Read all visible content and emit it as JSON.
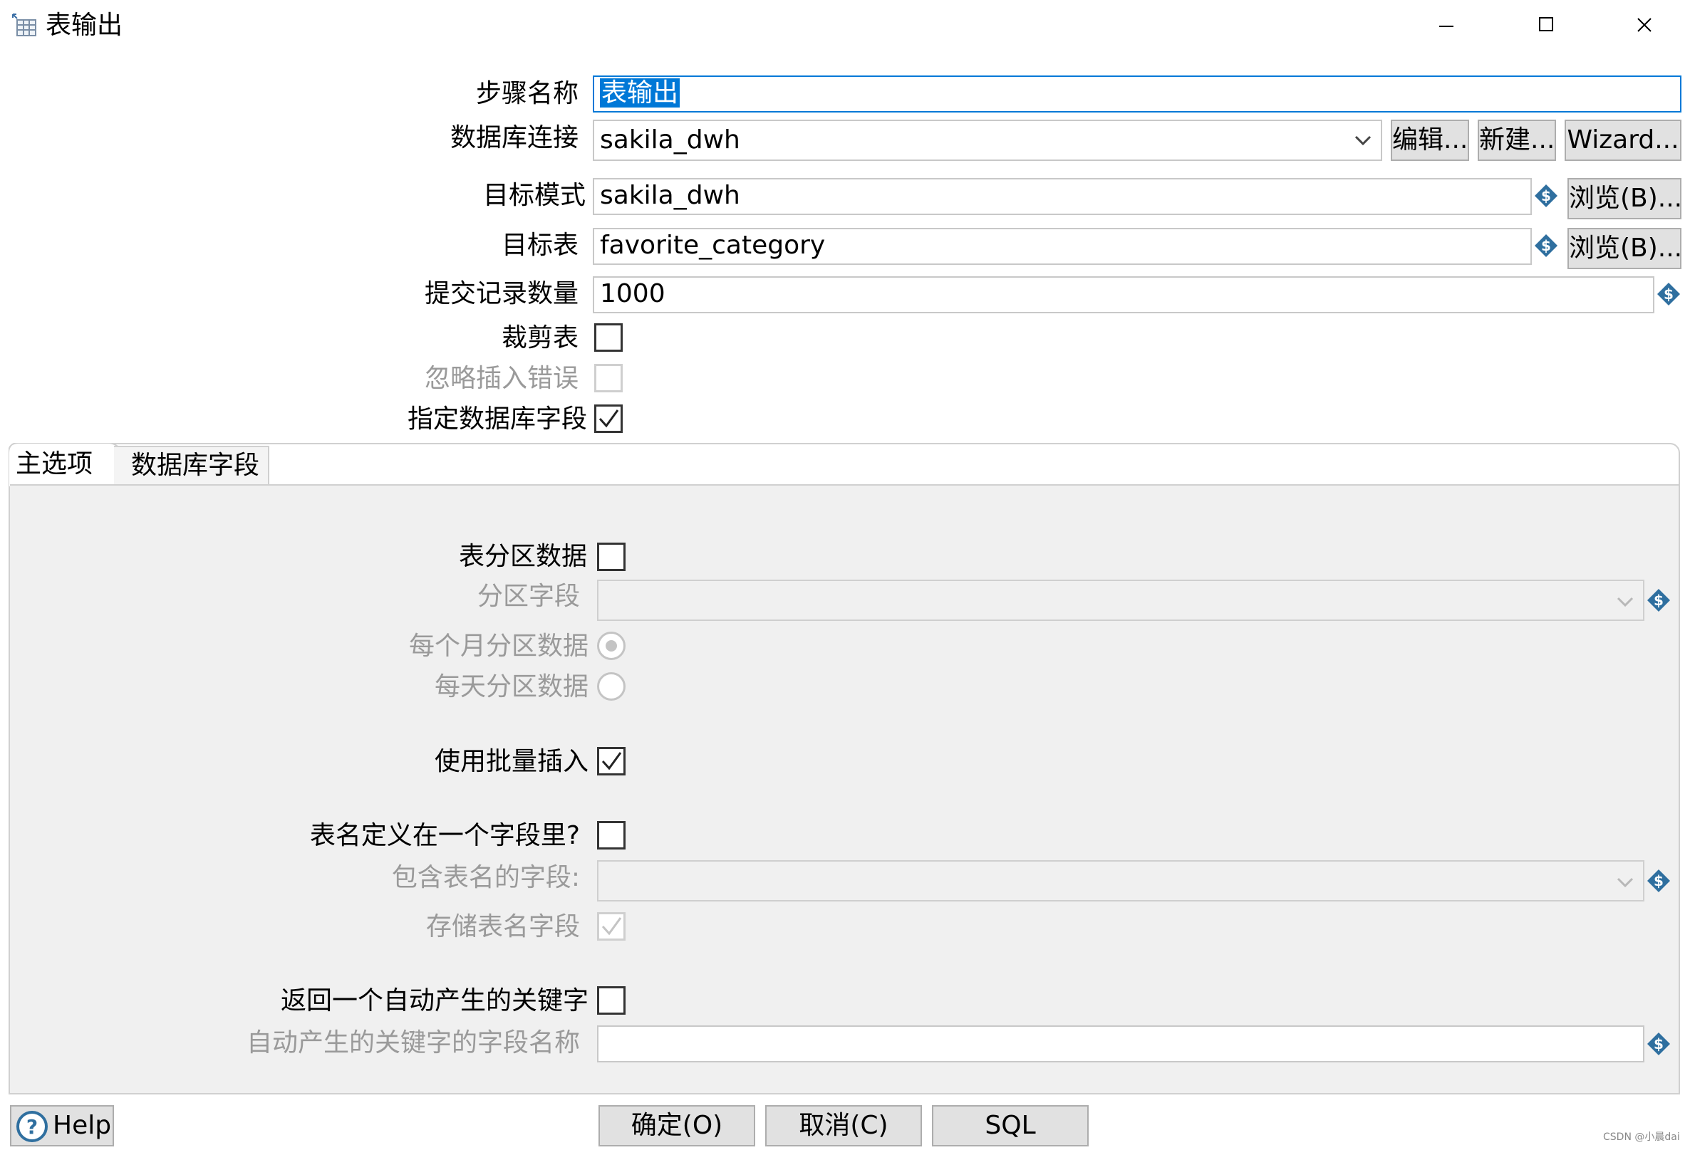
{
  "window": {
    "title": "表输出",
    "icon": "table-icon",
    "controls": [
      "minimize-icon",
      "maximize-icon",
      "close-icon"
    ]
  },
  "form": {
    "step_name_label": "步骤名称",
    "step_name_value": "表输出",
    "connection_label": "数据库连接",
    "connection_value": "sakila_dwh",
    "edit_button": "编辑...",
    "new_button": "新建...",
    "wizard_button": "Wizard...",
    "schema_label": "目标模式",
    "schema_value": "sakila_dwh",
    "browse_schema_button": "浏览(B)...",
    "table_label": "目标表",
    "table_value": "favorite_category",
    "browse_table_button": "浏览(B)...",
    "commit_label": "提交记录数量",
    "commit_value": "1000",
    "truncate_label": "裁剪表",
    "truncate_checked": false,
    "ignore_errors_label": "忽略插入错误",
    "ignore_errors_checked": false,
    "specify_fields_label": "指定数据库字段",
    "specify_fields_checked": true
  },
  "tabs": [
    {
      "label": "主选项",
      "active": true
    },
    {
      "label": "数据库字段",
      "active": false
    }
  ],
  "main_options": {
    "partition_label": "表分区数据",
    "partition_checked": false,
    "partition_field_label": "分区字段",
    "partition_field_value": "",
    "monthly_label": "每个月分区数据",
    "monthly_selected": true,
    "daily_label": "每天分区数据",
    "daily_selected": false,
    "batch_label": "使用批量插入",
    "batch_checked": true,
    "table_in_field_label": "表名定义在一个字段里?",
    "table_in_field_checked": false,
    "table_name_field_label": "包含表名的字段:",
    "table_name_field_value": "",
    "store_table_name_label": "存储表名字段",
    "store_table_name_checked": true,
    "return_key_label": "返回一个自动产生的关键字",
    "return_key_checked": false,
    "key_field_name_label": "自动产生的关键字的字段名称",
    "key_field_name_value": ""
  },
  "footer": {
    "help_button": "Help",
    "ok_button": "确定(O)",
    "cancel_button": "取消(C)",
    "sql_button": "SQL"
  },
  "watermark": "CSDN @小晨dai",
  "colors": {
    "selection": "#0078d7",
    "focus_border": "#0078d7",
    "button_bg": "#e1e1e1",
    "variable_icon": "#2f6f9f",
    "disabled_text": "#9a9a9a"
  }
}
